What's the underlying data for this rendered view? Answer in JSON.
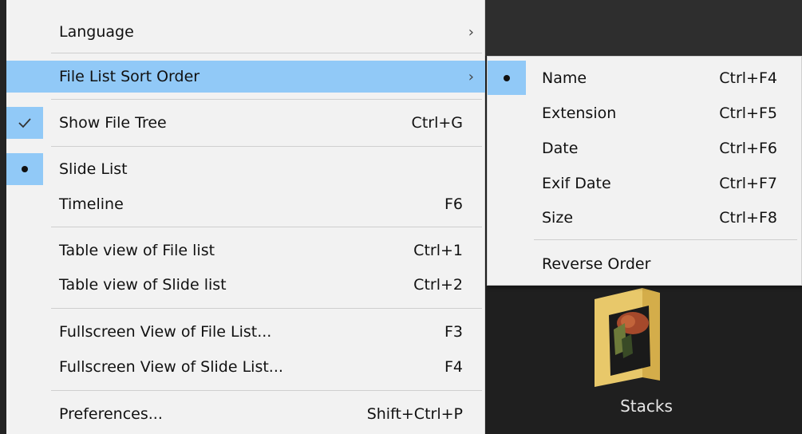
{
  "main_menu": {
    "items": [
      {
        "label": "Language",
        "shortcut": "",
        "has_submenu": true
      },
      {
        "label": "File List Sort Order",
        "shortcut": "",
        "has_submenu": true
      },
      {
        "label": "Show File Tree",
        "shortcut": "Ctrl+G",
        "checked": true
      },
      {
        "label": "Slide List",
        "shortcut": "",
        "radio": true
      },
      {
        "label": "Timeline",
        "shortcut": "F6"
      },
      {
        "label": "Table view of File list",
        "shortcut": "Ctrl+1"
      },
      {
        "label": "Table view of Slide list",
        "shortcut": "Ctrl+2"
      },
      {
        "label": "Fullscreen View of File List...",
        "shortcut": "F3"
      },
      {
        "label": "Fullscreen View of Slide List...",
        "shortcut": "F4"
      },
      {
        "label": "Preferences...",
        "shortcut": "Shift+Ctrl+P"
      }
    ],
    "submenu_arrow": "›"
  },
  "sort_submenu": {
    "items": [
      {
        "label": "Name",
        "shortcut": "Ctrl+F4",
        "selected": true
      },
      {
        "label": "Extension",
        "shortcut": "Ctrl+F5"
      },
      {
        "label": "Date",
        "shortcut": "Ctrl+F6"
      },
      {
        "label": "Exif Date",
        "shortcut": "Ctrl+F7"
      },
      {
        "label": "Size",
        "shortcut": "Ctrl+F8"
      },
      {
        "label": "Reverse Order",
        "shortcut": ""
      }
    ]
  },
  "background": {
    "folder_label": "Stacks"
  },
  "colors": {
    "menu_bg": "#f2f2f2",
    "highlight": "#91c9f7",
    "separator": "#cfcfcf",
    "dark_bg": "#1f1f1f"
  },
  "icons": {
    "submenu_arrow": "chevron-right-icon",
    "check": "checkmark-icon",
    "radio": "radio-dot-icon",
    "folder": "folder-icon"
  }
}
